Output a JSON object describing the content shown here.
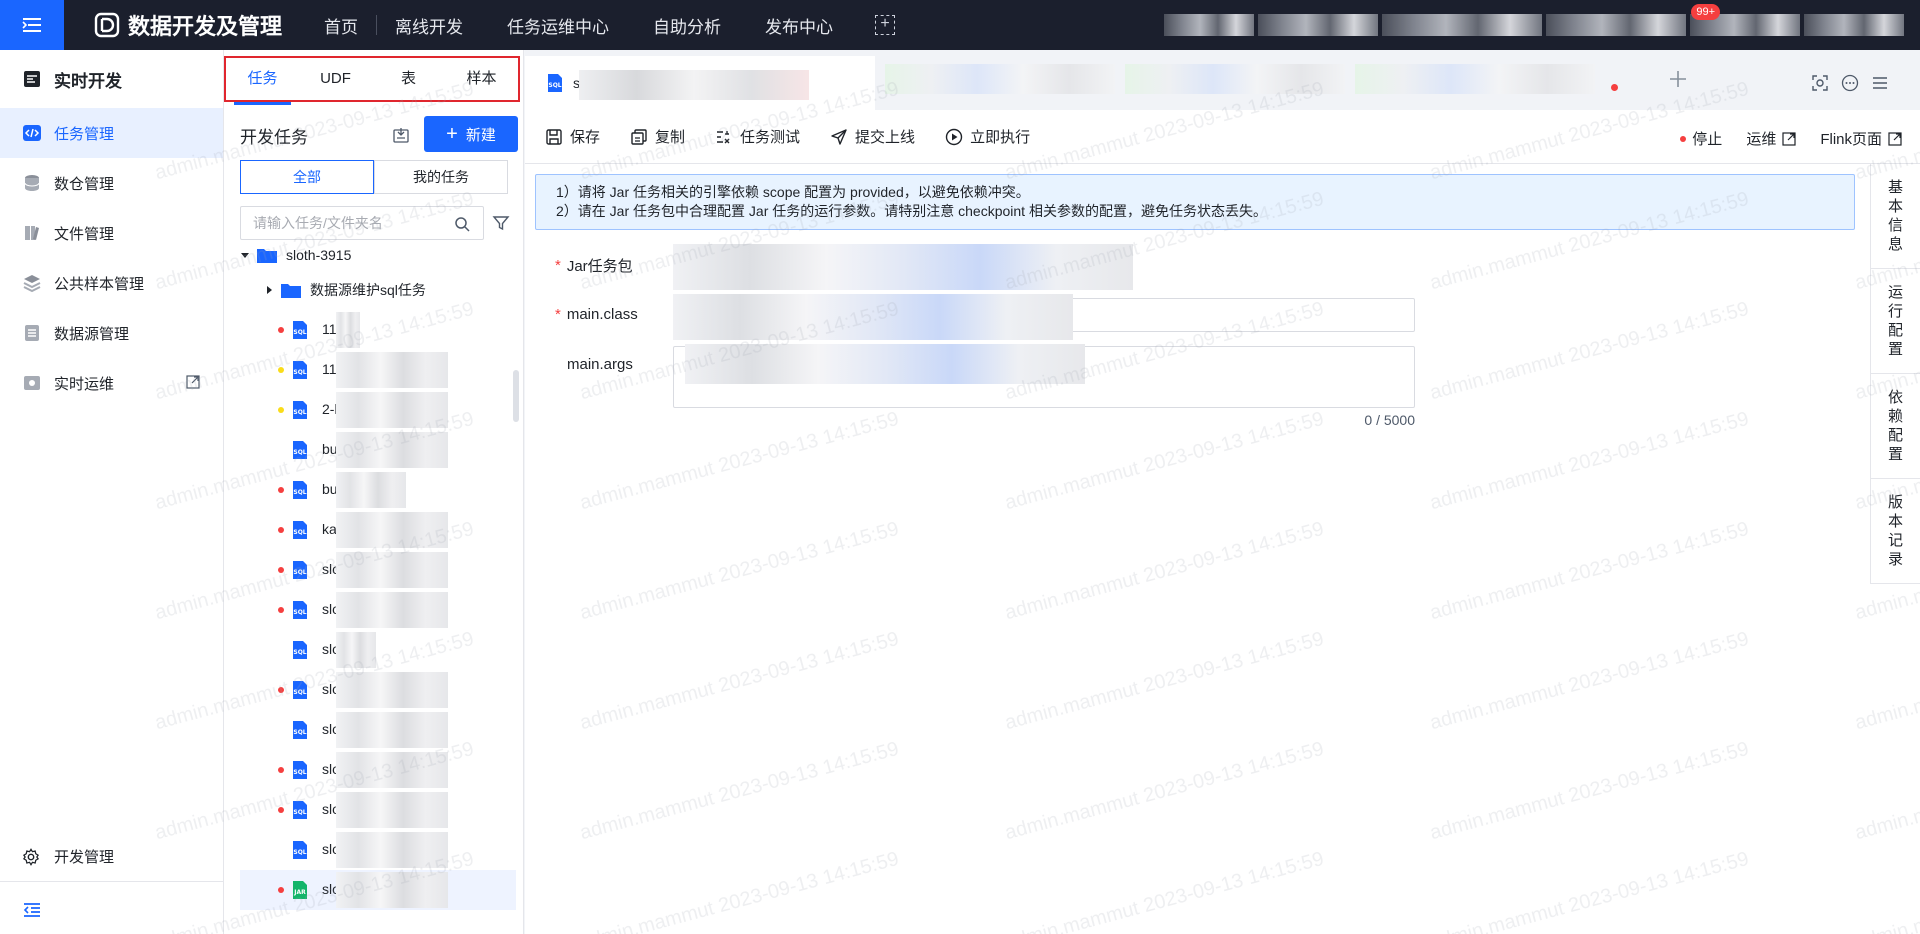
{
  "topbar": {
    "app_title": "数据开发及管理",
    "nav": [
      "首页",
      "离线开发",
      "任务运维中心",
      "自助分析",
      "发布中心"
    ],
    "badge": "99+"
  },
  "sidebar": {
    "title": "实时开发",
    "items": [
      {
        "label": "任务管理",
        "icon": "code-icon",
        "active": true
      },
      {
        "label": "数仓管理",
        "icon": "database-icon"
      },
      {
        "label": "文件管理",
        "icon": "file-icon"
      },
      {
        "label": "公共样本管理",
        "icon": "sample-icon"
      },
      {
        "label": "数据源管理",
        "icon": "datasource-icon"
      },
      {
        "label": "实时运维",
        "icon": "monitor-icon",
        "external": true
      }
    ],
    "bottom_item": "开发管理"
  },
  "tree_panel": {
    "tabs": [
      "任务",
      "UDF",
      "表",
      "样本"
    ],
    "heading": "开发任务",
    "new_button": "新建",
    "filters": [
      "全部",
      "我的任务"
    ],
    "search_placeholder": "请输入任务/文件夹名",
    "root_folder": "sloth-3915",
    "sub_folder": "数据源维护sql任务",
    "items": [
      {
        "label": "11",
        "dot": "#f53f3f",
        "type": "SQL"
      },
      {
        "label": "11",
        "dot": "#fadc19",
        "type": "SQL"
      },
      {
        "label": "2-l",
        "dot": "#fadc19",
        "type": "SQL"
      },
      {
        "label": "bu",
        "dot": "",
        "type": "SQL"
      },
      {
        "label": "bu",
        "dot": "#f53f3f",
        "type": "SQL"
      },
      {
        "label": "ka",
        "dot": "#f53f3f",
        "type": "SQL"
      },
      {
        "label": "slo",
        "dot": "#f53f3f",
        "type": "SQL"
      },
      {
        "label": "slo",
        "dot": "#f53f3f",
        "type": "SQL"
      },
      {
        "label": "slo",
        "dot": "",
        "type": "SQL"
      },
      {
        "label": "slo",
        "dot": "#f53f3f",
        "type": "SQL"
      },
      {
        "label": "slo",
        "dot": "",
        "type": "SQL"
      },
      {
        "label": "slo",
        "dot": "#f53f3f",
        "type": "SQL"
      },
      {
        "label": "slo",
        "dot": "#f53f3f",
        "type": "SQL"
      },
      {
        "label": "slo",
        "dot": "",
        "type": "SQL"
      },
      {
        "label": "slo",
        "dot": "#f53f3f",
        "type": "JAR"
      }
    ]
  },
  "editor": {
    "active_tab_name": "s",
    "toolbar": [
      "保存",
      "复制",
      "任务测试",
      "提交上线",
      "立即执行"
    ],
    "right_actions": [
      "停止",
      "运维",
      "Flink页面"
    ],
    "notice": [
      "1）请将 Jar 任务相关的引擎依赖 scope 配置为 provided，以避免依赖冲突。",
      "2）请在 Jar 任务包中合理配置 Jar 任务的运行参数。请特别注意 checkpoint 相关参数的配置，避免任务状态丢失。"
    ],
    "fields": {
      "jar_label": "Jar任务包",
      "class_label": "main.class",
      "args_label": "main.args",
      "counter": "0 / 5000"
    },
    "side_tabs": [
      "基本信息",
      "运行配置",
      "依赖配置",
      "版本记录"
    ]
  },
  "watermark": "admin.mammut 2023-09-13 14:15:59",
  "colors": {
    "accent": "#1a66ff",
    "topbar": "#1b1f2d",
    "danger": "#f53f3f"
  }
}
